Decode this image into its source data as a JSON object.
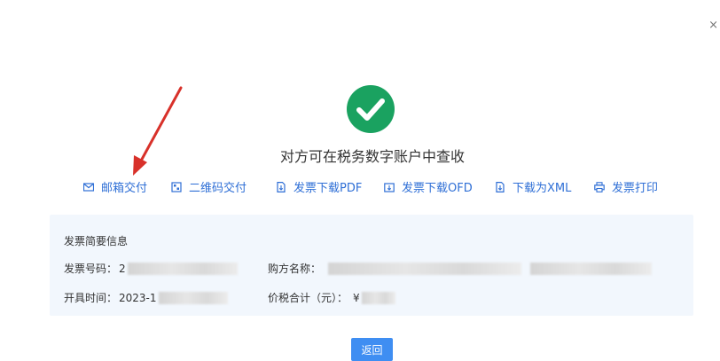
{
  "dialog": {
    "close_glyph": "×",
    "headline": "对方可在税务数字账户中查收",
    "success_icon": "check-circle-icon",
    "accent_color": "#1aa260",
    "link_color": "#2f6fd6"
  },
  "actions": [
    {
      "label": "邮箱交付",
      "icon": "mail-icon"
    },
    {
      "label": "二维码交付",
      "icon": "qrcode-icon"
    },
    {
      "label": "发票下载PDF",
      "icon": "pdf-icon"
    },
    {
      "label": "发票下载OFD",
      "icon": "ofd-icon"
    },
    {
      "label": "下载为XML",
      "icon": "xml-icon"
    },
    {
      "label": "发票打印",
      "icon": "printer-icon"
    }
  ],
  "summary": {
    "title": "发票简要信息",
    "invoice_no_label": "发票号码：",
    "invoice_no_value": "2",
    "buyer_label": "购方名称：",
    "issue_time_label": "开具时间：",
    "issue_time_value": "2023-1",
    "total_label": "价税合计（元）：",
    "total_value": "¥"
  },
  "buttons": {
    "return_label": "返回",
    "return_color": "#3f8ef2"
  },
  "annotation": {
    "arrow_color": "#d8312a"
  }
}
